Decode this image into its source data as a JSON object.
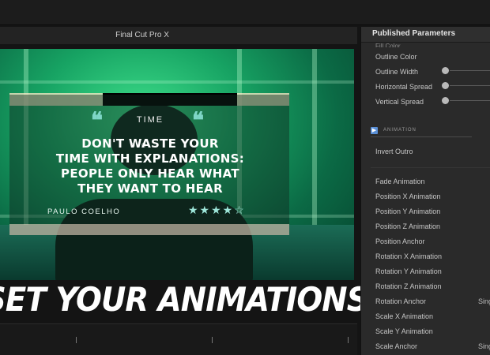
{
  "viewer": {
    "title": "Final Cut Pro X"
  },
  "title_card": {
    "tag": "TIME",
    "quote_lines": [
      "DON'T WASTE YOUR",
      "TIME WITH EXPLANATIONS:",
      "PEOPLE ONLY HEAR WHAT",
      "THEY WANT TO HEAR"
    ],
    "author": "PAULO COELHO",
    "stars": "★★★★☆",
    "rating": 4.5,
    "quote_glyph": "❝"
  },
  "banner": {
    "text": "SET YOUR ANIMATIONS"
  },
  "panel": {
    "title": "Published Parameters",
    "cut_off_label": "Fill Color",
    "params_top": [
      {
        "label": "Outline Color",
        "slider": false
      },
      {
        "label": "Outline Width",
        "slider": true
      },
      {
        "label": "Horizontal Spread",
        "slider": true
      },
      {
        "label": "Vertical Spread",
        "slider": true
      }
    ],
    "section": {
      "icon": "▶",
      "label": "ANIMATION"
    },
    "invert_outro": "Invert Outro",
    "params_anim": [
      {
        "label": "Fade Animation",
        "value": ""
      },
      {
        "label": "Position X Animation",
        "value": ""
      },
      {
        "label": "Position Y Animation",
        "value": ""
      },
      {
        "label": "Position Z Animation",
        "value": ""
      },
      {
        "label": "Position Anchor",
        "value": ""
      },
      {
        "label": "Rotation X Animation",
        "value": ""
      },
      {
        "label": "Rotation Y Animation",
        "value": ""
      },
      {
        "label": "Rotation Z Animation",
        "value": ""
      },
      {
        "label": "Rotation Anchor",
        "value": "Sing"
      },
      {
        "label": "Scale X Animation",
        "value": ""
      },
      {
        "label": "Scale Y Animation",
        "value": ""
      },
      {
        "label": "Scale Anchor",
        "value": "Sing"
      }
    ]
  },
  "colors": {
    "accent_green": "#17a363",
    "panel_bg": "#2a2a2a",
    "section_icon": "#5a8fd6"
  }
}
